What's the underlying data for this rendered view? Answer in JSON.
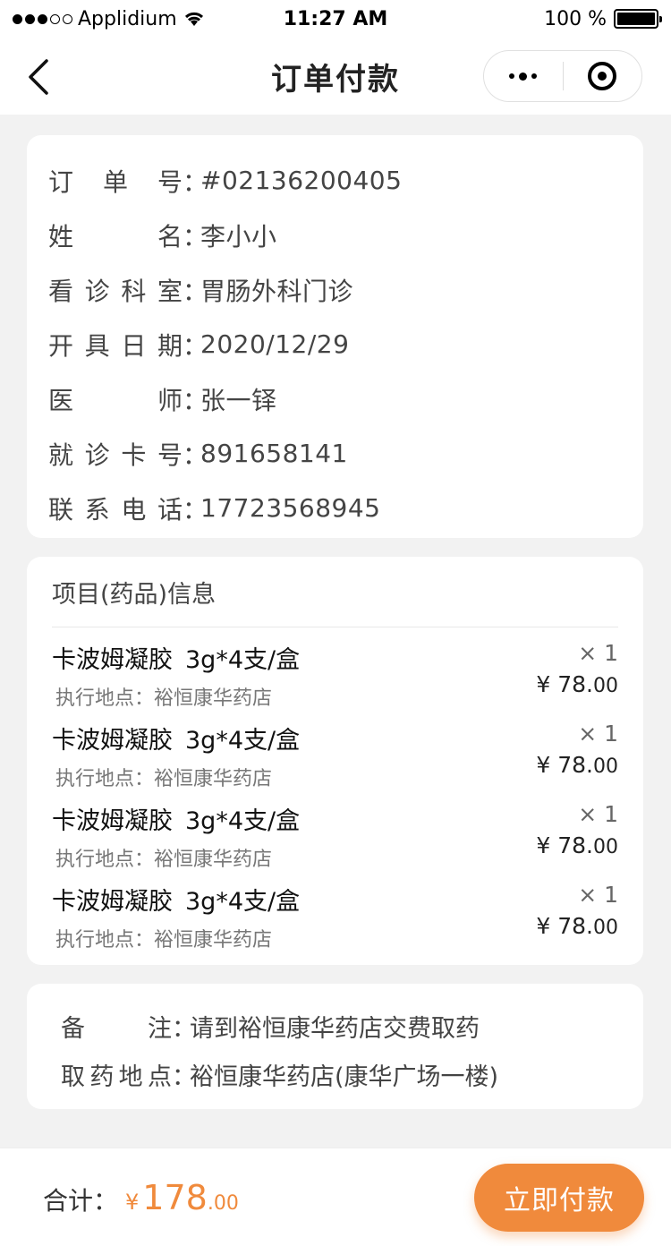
{
  "status_bar": {
    "carrier": "Applidium",
    "time": "11:27 AM",
    "battery": "100 %"
  },
  "nav": {
    "title": "订单付款"
  },
  "order_info": [
    {
      "label_chars": [
        "订",
        "单",
        "号"
      ],
      "value": "#02136200405"
    },
    {
      "label_chars": [
        "姓",
        "名"
      ],
      "value": "李小小"
    },
    {
      "label_chars": [
        "看",
        "诊",
        "科",
        "室"
      ],
      "value": "胃肠外科门诊"
    },
    {
      "label_chars": [
        "开",
        "具",
        "日",
        "期"
      ],
      "value": "2020/12/29"
    },
    {
      "label_chars": [
        "医",
        "师"
      ],
      "value": "张一铎"
    },
    {
      "label_chars": [
        "就",
        "诊",
        "卡",
        "号"
      ],
      "value": "891658141"
    },
    {
      "label_chars": [
        "联",
        "系",
        "电",
        "话"
      ],
      "value": "17723568945"
    }
  ],
  "colon": "：",
  "items_section": {
    "title": "项目(药品)信息",
    "items": [
      {
        "name": "卡波姆凝胶",
        "spec": "3g*4支/盒",
        "location": "执行地点：裕恒康华药店",
        "qty": "× 1",
        "price_int": "¥ 78.",
        "price_cents": "00"
      },
      {
        "name": "卡波姆凝胶",
        "spec": "3g*4支/盒",
        "location": "执行地点：裕恒康华药店",
        "qty": "× 1",
        "price_int": "¥ 78.",
        "price_cents": "00"
      },
      {
        "name": "卡波姆凝胶",
        "spec": "3g*4支/盒",
        "location": "执行地点：裕恒康华药店",
        "qty": "× 1",
        "price_int": "¥ 78.",
        "price_cents": "00"
      },
      {
        "name": "卡波姆凝胶",
        "spec": "3g*4支/盒",
        "location": "执行地点：裕恒康华药店",
        "qty": "× 1",
        "price_int": "¥ 78.",
        "price_cents": "00"
      }
    ]
  },
  "notes": [
    {
      "label_chars": [
        "备",
        "注"
      ],
      "value": "请到裕恒康华药店交费取药"
    },
    {
      "label_chars": [
        "取",
        "药",
        "地",
        "点"
      ],
      "value": "裕恒康华药店(康华广场一楼)"
    }
  ],
  "footer": {
    "total_label": "合计：",
    "currency": "¥",
    "total_int": "178",
    "total_cents": ".00",
    "pay_label": "立即付款"
  },
  "colors": {
    "accent": "#f08a3c",
    "background": "#f2f2f2"
  }
}
